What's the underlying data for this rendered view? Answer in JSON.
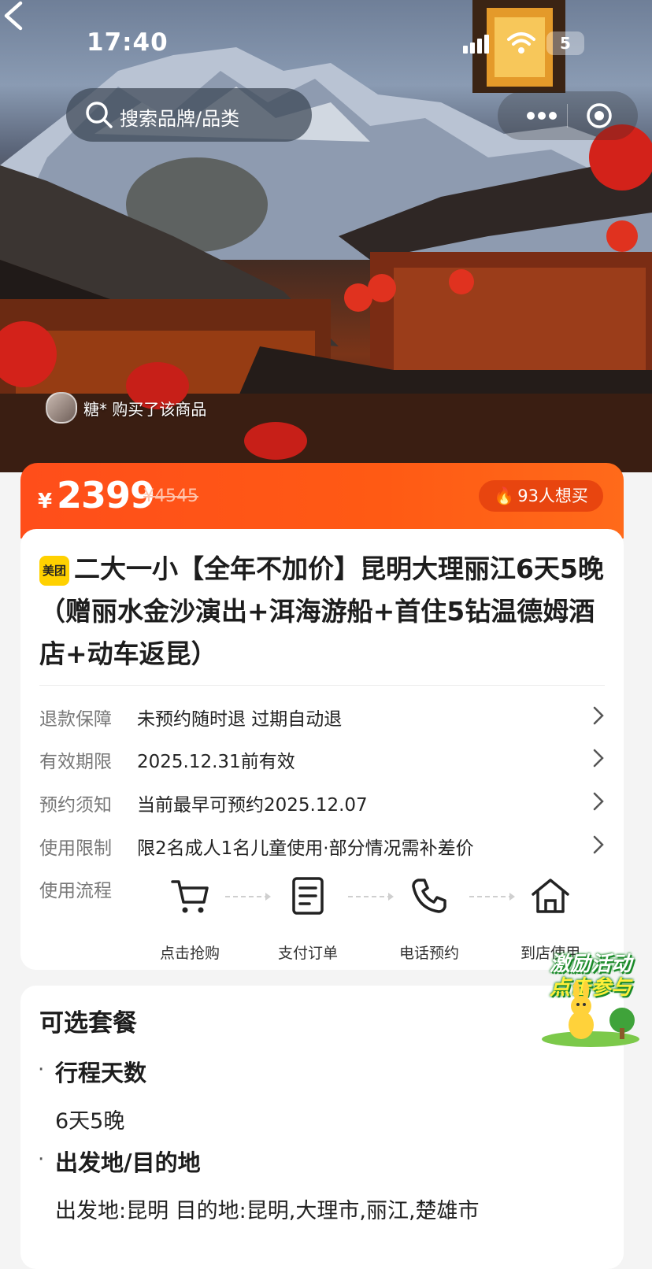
{
  "status_bar": {
    "time": "17:40",
    "battery": "5"
  },
  "search": {
    "placeholder": "搜索品牌/品类"
  },
  "hero": {
    "buyer_text": "糖* 购买了该商品"
  },
  "price": {
    "currency": "¥",
    "current": "2399",
    "original": "¥4545",
    "want_count": "93人想买"
  },
  "product": {
    "tag": "美团",
    "title": "二大一小【全年不加价】昆明大理丽江6天5晚（赠丽水金沙演出+洱海游船+首住5钻温德姆酒店+动车返昆）"
  },
  "info_rows": [
    {
      "key": "退款保障",
      "value": "未预约随时退 过期自动退"
    },
    {
      "key": "有效期限",
      "value": "2025.12.31前有效"
    },
    {
      "key": "预约须知",
      "value": "当前最早可预约2025.12.07"
    },
    {
      "key": "使用限制",
      "value": "限2名成人1名儿童使用·部分情况需补差价"
    }
  ],
  "flow": {
    "label": "使用流程",
    "steps": [
      {
        "label": "点击抢购",
        "icon": "cart-icon"
      },
      {
        "label": "支付订单",
        "icon": "order-icon"
      },
      {
        "label": "电话预约",
        "icon": "phone-icon"
      },
      {
        "label": "到店使用",
        "icon": "home-icon"
      }
    ]
  },
  "package": {
    "heading": "可选套餐",
    "sections": [
      {
        "title": "行程天数",
        "value": "6天5晚"
      },
      {
        "title": "出发地/目的地",
        "value": "出发地:昆明 目的地:昆明,大理市,丽江,楚雄市"
      }
    ]
  },
  "promo": {
    "line1": "激励活动",
    "line2": "点击参与"
  },
  "colors": {
    "accent": "#ff5214",
    "meituan_yellow": "#ffd100"
  }
}
